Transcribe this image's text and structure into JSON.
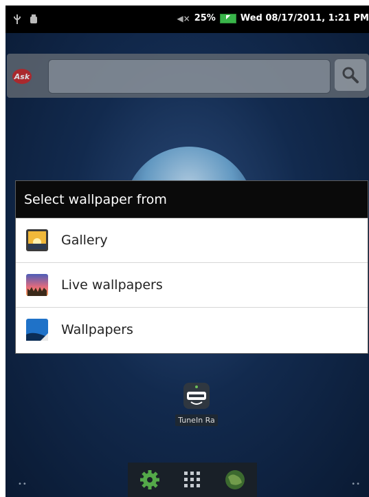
{
  "status_bar": {
    "volume_state": "muted",
    "battery_percent": "25%",
    "datetime": "Wed 08/17/2011, 1:21 PM",
    "icons": [
      "usb-icon",
      "android-debug-icon",
      "muted-speaker-icon",
      "battery-charging-icon"
    ]
  },
  "search": {
    "logo_text": "Ask",
    "placeholder": "",
    "icon": "search-icon"
  },
  "dialog": {
    "title": "Select wallpaper from",
    "options": [
      {
        "label": "Gallery",
        "icon": "gallery-icon"
      },
      {
        "label": "Live wallpapers",
        "icon": "live-wallpaper-icon"
      },
      {
        "label": "Wallpapers",
        "icon": "wallpaper-icon"
      }
    ]
  },
  "home": {
    "app_label": "TuneIn Ra",
    "app_icon": "tunein-radio-icon"
  },
  "dock": {
    "items": [
      {
        "icon": "settings-icon"
      },
      {
        "icon": "app-grid-icon"
      },
      {
        "icon": "browser-globe-icon"
      }
    ]
  },
  "colors": {
    "accent_battery": "#39b54a",
    "ask_logo": "#c62b2b"
  }
}
